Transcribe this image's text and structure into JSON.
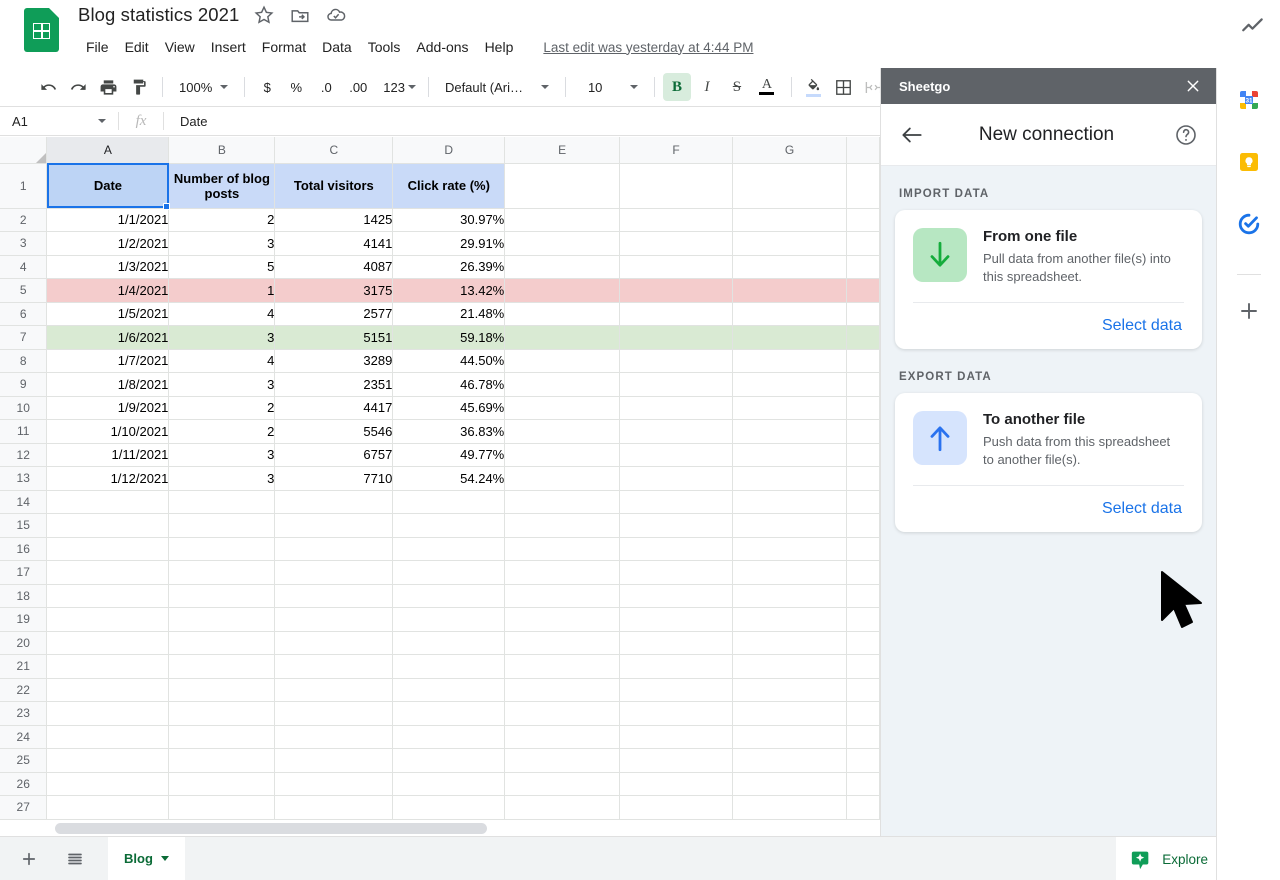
{
  "header": {
    "doc_title": "Blog statistics 2021",
    "logo_icon": "sheets-logo-icon",
    "star_icon": "star-icon",
    "move_icon": "move-to-folder-icon",
    "cloud_icon": "cloud-saved-icon",
    "trend_icon": "trending-up-icon",
    "menus": [
      "File",
      "Edit",
      "View",
      "Insert",
      "Format",
      "Data",
      "Tools",
      "Add-ons",
      "Help"
    ],
    "last_edit": "Last edit was yesterday at 4:44 PM"
  },
  "toolbar": {
    "undo_icon": "undo-icon",
    "redo_icon": "redo-icon",
    "print_icon": "print-icon",
    "paint_icon": "paint-format-icon",
    "zoom_value": "100%",
    "currency": "$",
    "percent": "%",
    "decrease_decimal": ".0",
    "increase_decimal": ".00",
    "more_formats": "123",
    "font_family": "Default (Ari…",
    "font_size": "10",
    "bold": "B",
    "italic": "I",
    "strikethrough": "S",
    "text_color": "A",
    "fill_color_icon": "fill-color-icon",
    "borders_icon": "borders-icon",
    "merge_icon": "merge-cells-icon"
  },
  "formula_bar": {
    "name_box": "A1",
    "fx_label": "fx",
    "value": "Date"
  },
  "grid": {
    "columns": [
      "A",
      "B",
      "C",
      "D",
      "E",
      "F",
      "G"
    ],
    "selected_column": "A",
    "header_row": [
      "Date",
      "Number of blog posts",
      "Total visitors",
      "Click rate (%)"
    ],
    "rows": [
      {
        "n": "2",
        "highlight": "none",
        "cells": [
          "1/1/2021",
          "2",
          "1425",
          "30.97%"
        ]
      },
      {
        "n": "3",
        "highlight": "none",
        "cells": [
          "1/2/2021",
          "3",
          "4141",
          "29.91%"
        ]
      },
      {
        "n": "4",
        "highlight": "none",
        "cells": [
          "1/3/2021",
          "5",
          "4087",
          "26.39%"
        ]
      },
      {
        "n": "5",
        "highlight": "red",
        "cells": [
          "1/4/2021",
          "1",
          "3175",
          "13.42%"
        ]
      },
      {
        "n": "6",
        "highlight": "none",
        "cells": [
          "1/5/2021",
          "4",
          "2577",
          "21.48%"
        ]
      },
      {
        "n": "7",
        "highlight": "green",
        "cells": [
          "1/6/2021",
          "3",
          "5151",
          "59.18%"
        ]
      },
      {
        "n": "8",
        "highlight": "none",
        "cells": [
          "1/7/2021",
          "4",
          "3289",
          "44.50%"
        ]
      },
      {
        "n": "9",
        "highlight": "none",
        "cells": [
          "1/8/2021",
          "3",
          "2351",
          "46.78%"
        ]
      },
      {
        "n": "10",
        "highlight": "none",
        "cells": [
          "1/9/2021",
          "2",
          "4417",
          "45.69%"
        ]
      },
      {
        "n": "11",
        "highlight": "none",
        "cells": [
          "1/10/2021",
          "2",
          "5546",
          "36.83%"
        ]
      },
      {
        "n": "12",
        "highlight": "none",
        "cells": [
          "1/11/2021",
          "3",
          "6757",
          "49.77%"
        ]
      },
      {
        "n": "13",
        "highlight": "none",
        "cells": [
          "1/12/2021",
          "3",
          "7710",
          "54.24%"
        ]
      },
      {
        "n": "14",
        "highlight": "none",
        "cells": [
          "",
          "",
          "",
          ""
        ]
      },
      {
        "n": "15",
        "highlight": "none",
        "cells": [
          "",
          "",
          "",
          ""
        ]
      },
      {
        "n": "16",
        "highlight": "none",
        "cells": [
          "",
          "",
          "",
          ""
        ]
      },
      {
        "n": "17",
        "highlight": "none",
        "cells": [
          "",
          "",
          "",
          ""
        ]
      },
      {
        "n": "18",
        "highlight": "none",
        "cells": [
          "",
          "",
          "",
          ""
        ]
      },
      {
        "n": "19",
        "highlight": "none",
        "cells": [
          "",
          "",
          "",
          ""
        ]
      },
      {
        "n": "20",
        "highlight": "none",
        "cells": [
          "",
          "",
          "",
          ""
        ]
      },
      {
        "n": "21",
        "highlight": "none",
        "cells": [
          "",
          "",
          "",
          ""
        ]
      },
      {
        "n": "22",
        "highlight": "none",
        "cells": [
          "",
          "",
          "",
          ""
        ]
      },
      {
        "n": "23",
        "highlight": "none",
        "cells": [
          "",
          "",
          "",
          ""
        ]
      },
      {
        "n": "24",
        "highlight": "none",
        "cells": [
          "",
          "",
          "",
          ""
        ]
      },
      {
        "n": "25",
        "highlight": "none",
        "cells": [
          "",
          "",
          "",
          ""
        ]
      },
      {
        "n": "26",
        "highlight": "none",
        "cells": [
          "",
          "",
          "",
          ""
        ]
      },
      {
        "n": "27",
        "highlight": "none",
        "cells": [
          "",
          "",
          "",
          ""
        ]
      }
    ],
    "colors": {
      "header_fill": "#c9daf8",
      "red_fill": "#f4cccc",
      "green_fill": "#d9ead3",
      "selection": "#1a73e8"
    }
  },
  "sheetgo": {
    "app_name": "Sheetgo",
    "close_icon": "close-icon",
    "back_icon": "arrow-back-icon",
    "heading": "New connection",
    "help_icon": "help-circle-icon",
    "import_section_label": "IMPORT DATA",
    "export_section_label": "EXPORT DATA",
    "import_card": {
      "icon": "arrow-down-icon",
      "title": "From one file",
      "description": "Pull data from another file(s) into this spreadsheet.",
      "action": "Select data",
      "icon_color": "#15ac3c",
      "icon_bg": "#b7e7c2"
    },
    "export_card": {
      "icon": "arrow-up-icon",
      "title": "To another file",
      "description": "Push data from this spreadsheet to another file(s).",
      "action": "Select data",
      "icon_color": "#2a72ef",
      "icon_bg": "#d6e4fd"
    }
  },
  "right_rail": {
    "items": [
      {
        "name": "google-calendar-icon"
      },
      {
        "name": "google-keep-icon"
      },
      {
        "name": "google-tasks-icon"
      }
    ],
    "add_on_icon": "plus-icon"
  },
  "bottom_bar": {
    "add_sheet_icon": "plus-icon",
    "all_sheets_icon": "all-sheets-icon",
    "tabs": [
      {
        "label": "Blog",
        "active": true
      }
    ],
    "explore_label": "Explore",
    "explore_icon": "explore-icon",
    "chevron_icon": "chevron-right-icon"
  },
  "cursor": {
    "icon": "mouse-pointer-icon"
  }
}
